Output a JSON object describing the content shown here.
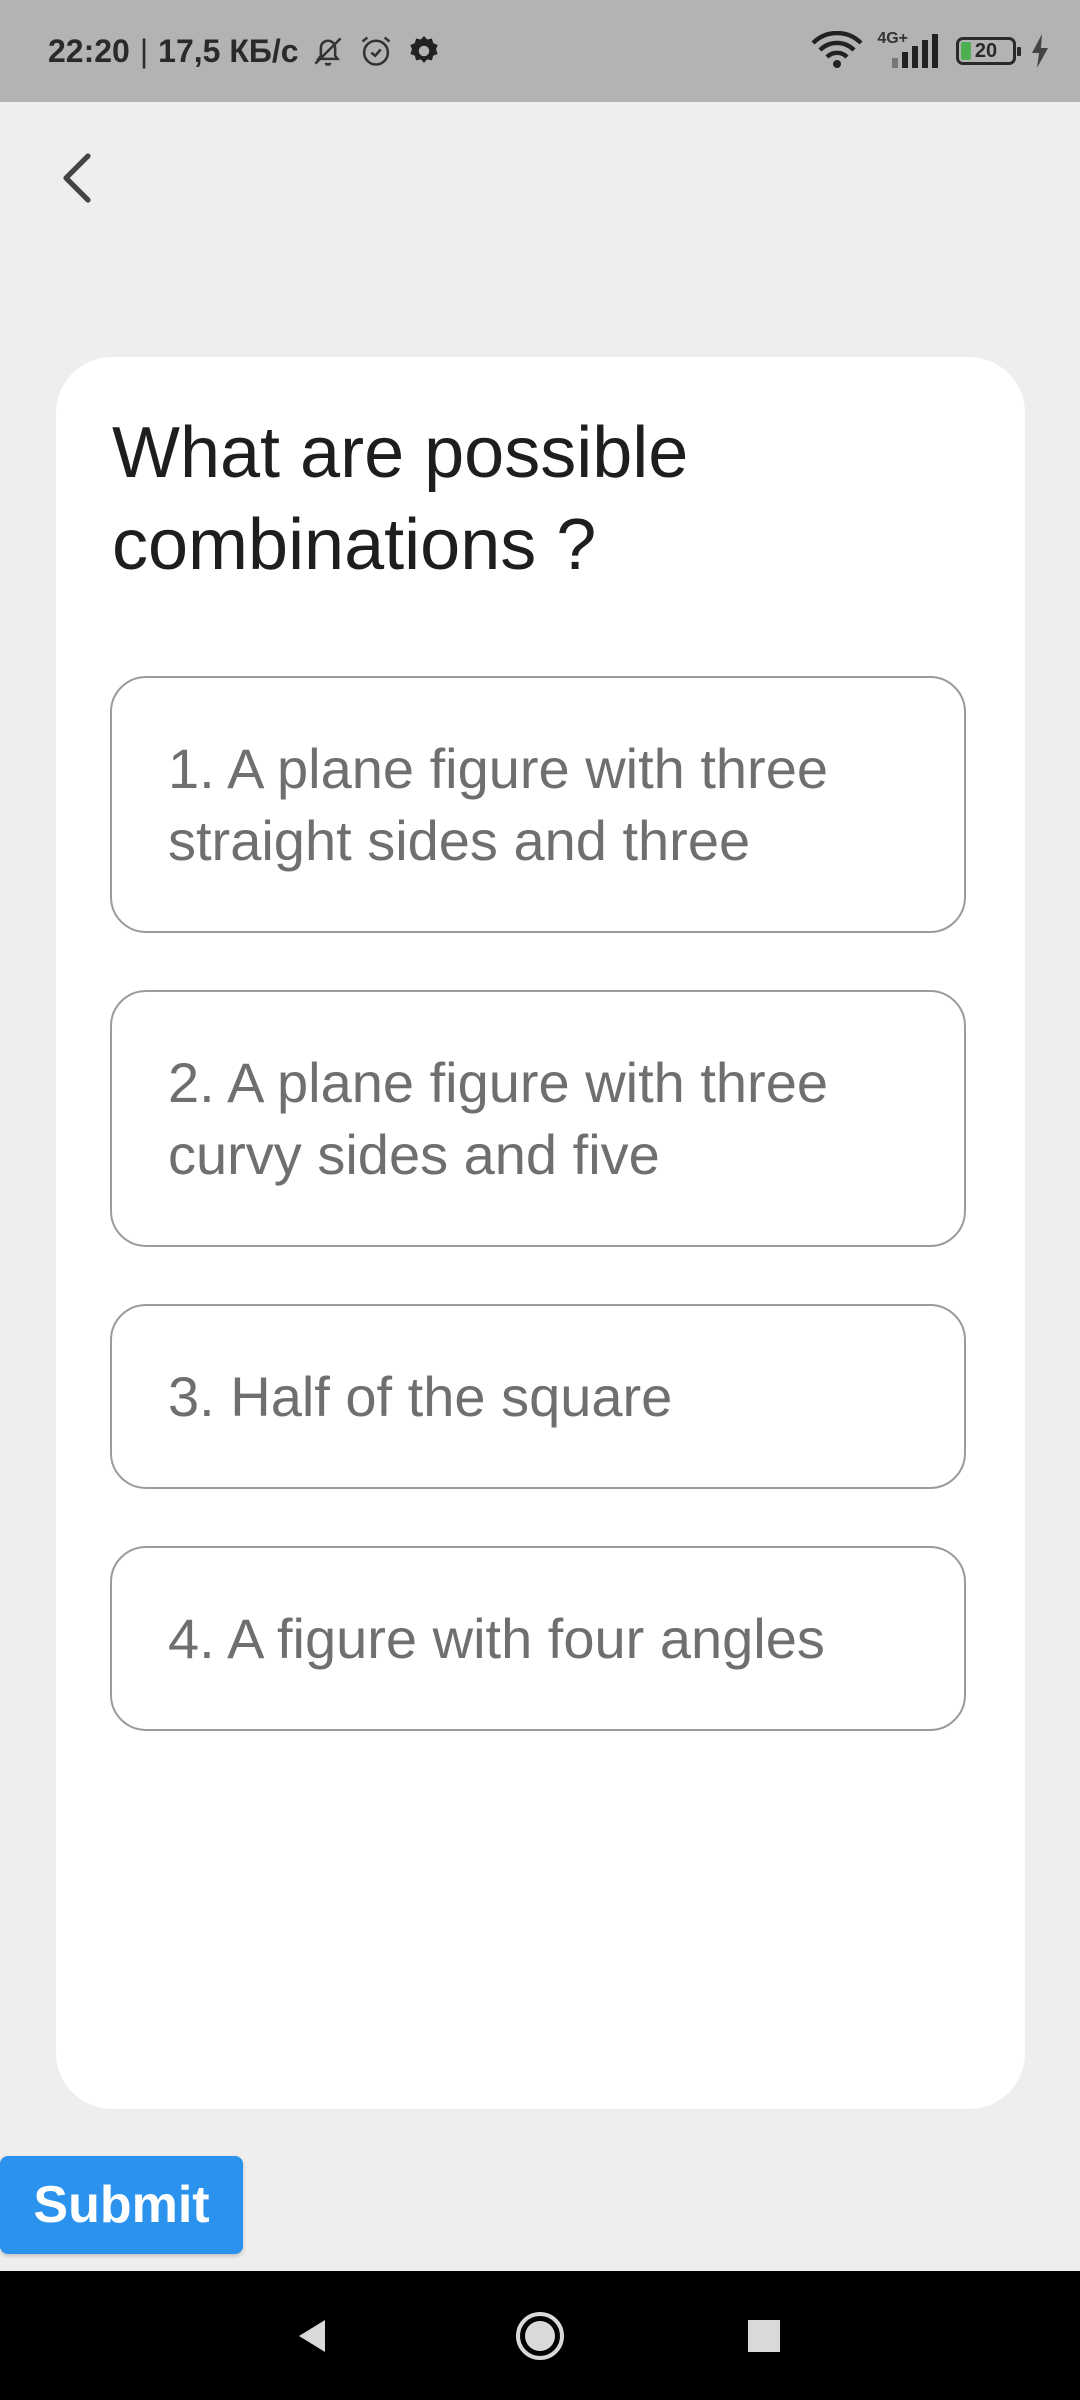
{
  "status_bar": {
    "time": "22:20",
    "separator": "|",
    "speed": "17,5 КБ/с",
    "network": "4G+",
    "battery": "20",
    "icons": [
      "bell-off-icon",
      "alarm-icon",
      "gear-icon",
      "wifi-icon",
      "signal-icon",
      "battery-icon",
      "charging-icon"
    ]
  },
  "header": {
    "back_icon": "chevron-left-icon"
  },
  "question": {
    "text": "What are possible combinations ?"
  },
  "options": [
    {
      "label": "1. A plane figure with three straight sides and three"
    },
    {
      "label": "2. A plane figure with three curvy sides and five"
    },
    {
      "label": "3. Half of the square"
    },
    {
      "label": "4. A figure with four angles"
    }
  ],
  "submit": {
    "label": "Submit",
    "color": "#2b93ee"
  },
  "nav_bar": {
    "icons": [
      "back-triangle-icon",
      "home-circle-icon",
      "recents-square-icon"
    ]
  }
}
